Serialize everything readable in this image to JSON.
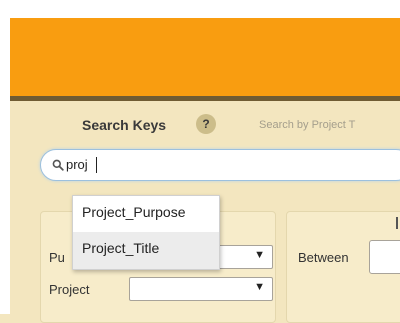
{
  "search_keys": {
    "title": "Search Keys",
    "help_badge": "?",
    "search_by_text": "Search by Project T",
    "search_value": "proj",
    "icons": {
      "search": "magnifier-icon",
      "help": "question-icon"
    }
  },
  "autocomplete": {
    "items": [
      {
        "label": "Project_Purpose"
      },
      {
        "label": "Project_Title"
      }
    ]
  },
  "filters": {
    "purpose_label_partial": "Pu",
    "project_label": "Project",
    "between_label": "Between",
    "dropdown_arrow": "▼"
  },
  "colors": {
    "header": "#f99d10",
    "panel": "#f3e6bf",
    "rule": "#6f5b33",
    "search_border": "#9cc0de"
  }
}
